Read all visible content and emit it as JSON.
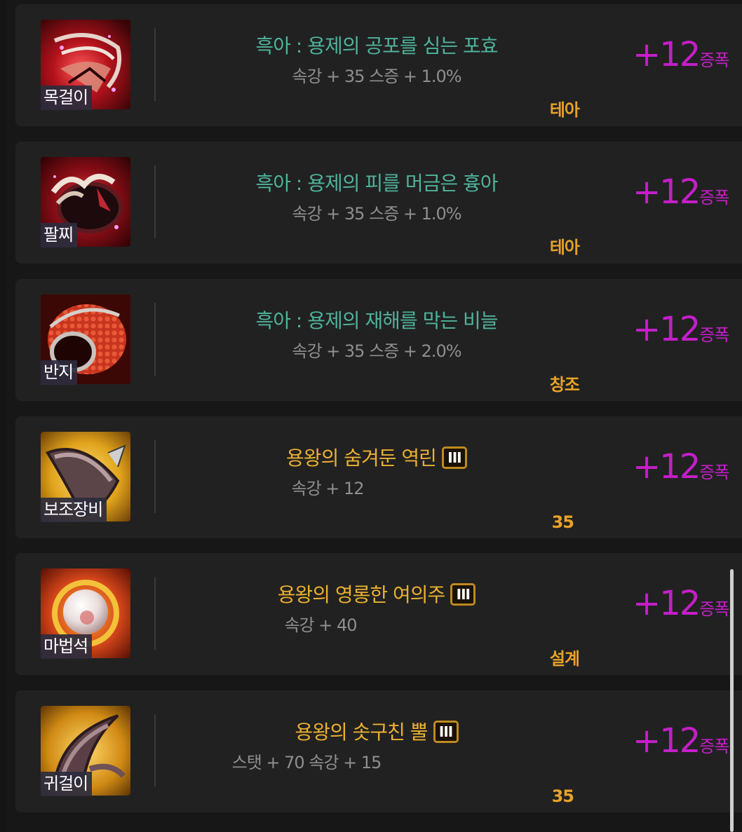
{
  "items": [
    {
      "slot": "목걸이",
      "name": "흑아 : 용제의 공포를 심는 포효",
      "name_color": "teal",
      "tier_badge": "",
      "stats": "속강 + 35 스증 + 1.0%",
      "set_tag": "테아",
      "amp_value": "+12",
      "amp_unit": "증폭",
      "icon": "necklace-icon"
    },
    {
      "slot": "팔찌",
      "name": "흑아 : 용제의 피를 머금은 흉아",
      "name_color": "teal",
      "tier_badge": "",
      "stats": "속강 + 35 스증 + 1.0%",
      "set_tag": "테아",
      "amp_value": "+12",
      "amp_unit": "증폭",
      "icon": "bracelet-icon"
    },
    {
      "slot": "반지",
      "name": "흑아 : 용제의 재해를 막는 비늘",
      "name_color": "teal",
      "tier_badge": "",
      "stats": "속강 + 35 스증 + 2.0%",
      "set_tag": "창조",
      "amp_value": "+12",
      "amp_unit": "증폭",
      "icon": "ring-icon"
    },
    {
      "slot": "보조장비",
      "name": "용왕의 숨겨둔 역린",
      "name_color": "gold",
      "tier_badge": "III",
      "stats": "속강 + 12",
      "set_tag": "35",
      "amp_value": "+12",
      "amp_unit": "증폭",
      "icon": "sub-equipment-icon"
    },
    {
      "slot": "마법석",
      "name": "용왕의 영롱한 여의주",
      "name_color": "gold",
      "tier_badge": "III",
      "stats": "속강 + 40",
      "set_tag": "설계",
      "amp_value": "+12",
      "amp_unit": "증폭",
      "icon": "magic-stone-icon"
    },
    {
      "slot": "귀걸이",
      "name": "용왕의 솟구친 뿔",
      "name_color": "gold",
      "tier_badge": "III",
      "stats": "스탯 + 70 속강 + 15",
      "set_tag": "35",
      "amp_value": "+12",
      "amp_unit": "증폭",
      "icon": "earring-icon"
    }
  ],
  "colors": {
    "teal_name": "#4fb39a",
    "gold_name": "#ebb031",
    "amp": "#c41ec9",
    "set_tag": "#e8a228",
    "stats": "#8e8e8e",
    "row_bg": "#212121",
    "page_bg": "#171717"
  }
}
